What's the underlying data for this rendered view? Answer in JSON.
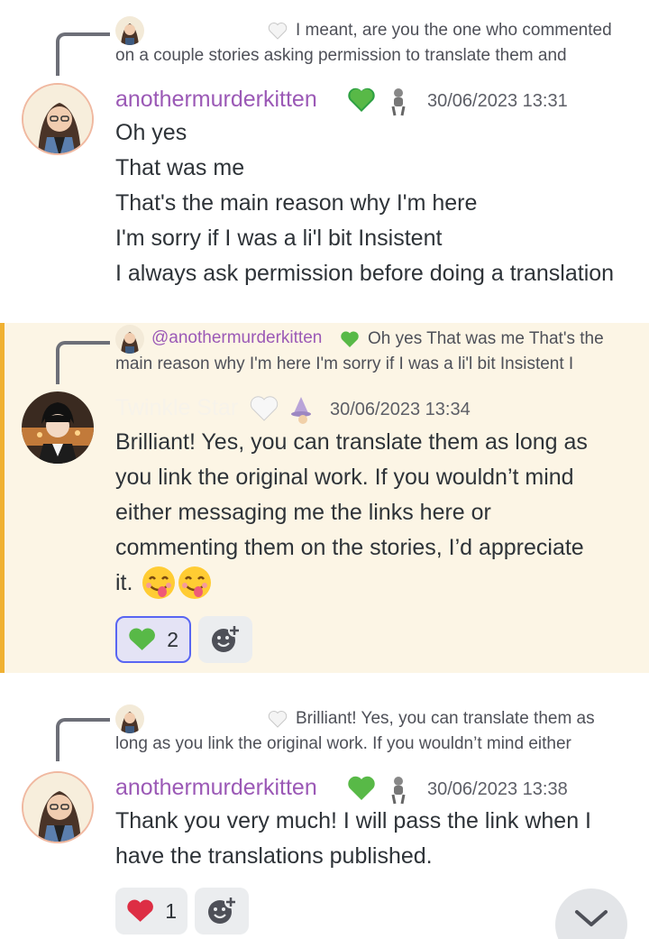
{
  "colors": {
    "username_purple": "#9b59b6",
    "highlight_bg": "#fcf5e5",
    "highlight_bar": "#f0b132",
    "text_dark": "#2e3338",
    "text_muted": "#5c5e66",
    "reaction_bg": "#ebedef",
    "reaction_selected_border": "#5865f2"
  },
  "messages": [
    {
      "reply": {
        "author": "",
        "text": "I meant, are you the one who commented on a couple stories asking permission to translate them and"
      },
      "author": "anothermurderkitten",
      "timestamp": "30/06/2023 13:31",
      "lines": [
        "Oh yes",
        "That was me",
        "That's the main reason why I'm here",
        "I'm sorry if I was a li'l bit Insistent",
        "I always ask permission before doing a translation"
      ]
    },
    {
      "reply": {
        "author": "@anothermurderkitten",
        "text": "Oh yes That was me That's the main reason why I'm here I'm sorry if I was a li'l bit Insistent I"
      },
      "author": "Twinkle Star",
      "timestamp": "30/06/2023 13:34",
      "lines": [
        "Brilliant! Yes, you can translate them as long as",
        "you link the original work. If you wouldn’t mind",
        "either messaging me the links here or",
        "commenting them on the stories, I’d appreciate",
        "it."
      ],
      "reactions": [
        {
          "emoji": "green-heart",
          "count": "2",
          "selected": true
        }
      ]
    },
    {
      "reply": {
        "author": "",
        "text": "Brilliant! Yes, you can translate them as long as you link the original work. If you wouldn’t mind either"
      },
      "author": "anothermurderkitten",
      "timestamp": "30/06/2023 13:38",
      "lines": [
        "Thank you very much! I will pass the link when I",
        "have the translations published."
      ],
      "reactions": [
        {
          "emoji": "red-heart",
          "count": "1",
          "selected": false
        }
      ]
    }
  ],
  "icons": {
    "add_reaction": "add-reaction-icon",
    "scroll_down": "chevron-down-icon"
  }
}
